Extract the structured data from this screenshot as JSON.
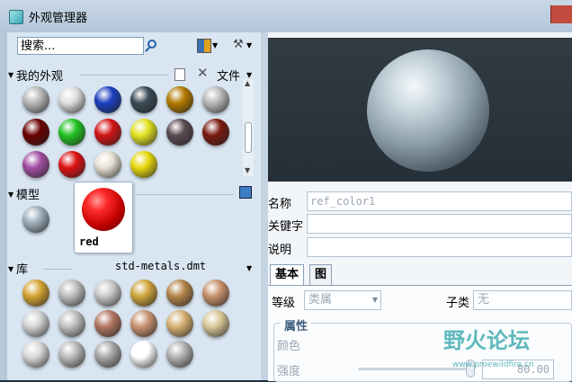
{
  "window": {
    "title": "外观管理器"
  },
  "left": {
    "search_value": "搜索...",
    "my_appearances": {
      "title": "我的外观",
      "file_menu": "文件",
      "swatches": [
        "#b8b8b8",
        "#dddddd",
        "#1b3fbf",
        "#3a4a56",
        "#b37a00",
        "#b9b9b9",
        "#6a0000",
        "#22c322",
        "#d21414",
        "#e2e222",
        "#5a4a52",
        "#7a1a10",
        "#a24da2",
        "#dd1111",
        "#e6e1d2",
        "#e6d80c"
      ]
    },
    "model": {
      "title": "模型",
      "swatches": [
        "#9fb0bd"
      ],
      "selected_label": "red"
    },
    "library": {
      "title": "库",
      "file": "std-metals.dmt",
      "swatches": [
        "#d3a431",
        "#bdbdbd",
        "#c9c9c9",
        "#cfa53d",
        "#b4844a",
        "#c7926a",
        "#d4d4d4",
        "#c0c0c0",
        "#b27561",
        "#c89371",
        "#d6b072",
        "#d9c797",
        "#d9d9d9",
        "#bababa",
        "#a8a8a8",
        "#ffffff",
        "#b1b1b1"
      ]
    }
  },
  "right": {
    "fields": [
      {
        "label": "名称",
        "value": "ref_color1"
      },
      {
        "label": "关键字",
        "value": ""
      },
      {
        "label": "说明",
        "value": ""
      }
    ],
    "tabs": [
      "基本",
      "图"
    ],
    "level_label": "等级",
    "level_value": "类属",
    "subclass_label": "子类",
    "subclass_value": "无",
    "group_title": "属性",
    "color_label": "颜色",
    "intensity_label": "强度",
    "intensity_value": "80.00"
  },
  "watermark": {
    "text": "野火论坛",
    "url": "www.proewildfire.cn"
  }
}
